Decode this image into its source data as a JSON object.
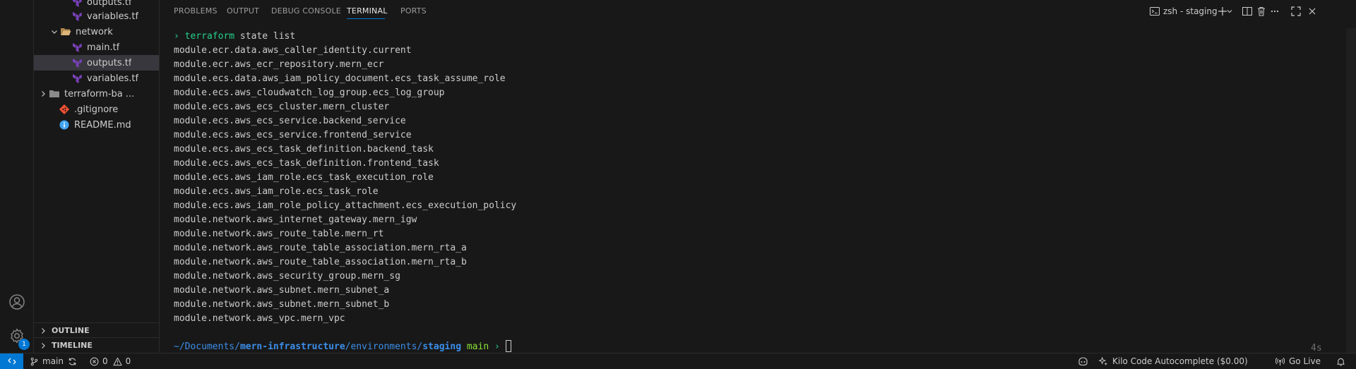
{
  "sidebar": {
    "tree": [
      {
        "label": "outputs.tf",
        "type": "terraform"
      },
      {
        "label": "variables.tf",
        "type": "terraform"
      },
      {
        "label": "network",
        "type": "folder-open"
      },
      {
        "label": "main.tf",
        "type": "terraform"
      },
      {
        "label": "outputs.tf",
        "type": "terraform",
        "selected": true
      },
      {
        "label": "variables.tf",
        "type": "terraform"
      },
      {
        "label": "terraform-ba ...",
        "type": "folder"
      },
      {
        "label": ".gitignore",
        "type": "git"
      },
      {
        "label": "README.md",
        "type": "info"
      }
    ],
    "outline_label": "OUTLINE",
    "timeline_label": "TIMELINE"
  },
  "activity": {
    "accounts_icon": "account-icon",
    "manage_icon": "gear-icon",
    "manage_badge": "1"
  },
  "panel": {
    "tabs": [
      {
        "label": "PROBLEMS"
      },
      {
        "label": "OUTPUT"
      },
      {
        "label": "DEBUG CONSOLE"
      },
      {
        "label": "TERMINAL",
        "active": true
      },
      {
        "label": "PORTS"
      }
    ],
    "terminal_title": "zsh - staging"
  },
  "terminal": {
    "prompt_symbol": "›",
    "command_name": "terraform",
    "command_args": " state list",
    "output": [
      "module.ecr.data.aws_caller_identity.current",
      "module.ecr.aws_ecr_repository.mern_ecr",
      "module.ecs.data.aws_iam_policy_document.ecs_task_assume_role",
      "module.ecs.aws_cloudwatch_log_group.ecs_log_group",
      "module.ecs.aws_ecs_cluster.mern_cluster",
      "module.ecs.aws_ecs_service.backend_service",
      "module.ecs.aws_ecs_service.frontend_service",
      "module.ecs.aws_ecs_task_definition.backend_task",
      "module.ecs.aws_ecs_task_definition.frontend_task",
      "module.ecs.aws_iam_role.ecs_task_execution_role",
      "module.ecs.aws_iam_role.ecs_task_role",
      "module.ecs.aws_iam_role_policy_attachment.ecs_execution_policy",
      "module.network.aws_internet_gateway.mern_igw",
      "module.network.aws_route_table.mern_rt",
      "module.network.aws_route_table_association.mern_rta_a",
      "module.network.aws_route_table_association.mern_rta_b",
      "module.network.aws_security_group.mern_sg",
      "module.network.aws_subnet.mern_subnet_a",
      "module.network.aws_subnet.mern_subnet_b",
      "module.network.aws_vpc.mern_vpc"
    ],
    "cwd": {
      "home": "~/",
      "seg1": "Documents",
      "sep1": "/",
      "seg2": "mern-infrastructure",
      "sep2": "/",
      "seg3": "environments",
      "sep3": "/",
      "seg4": "staging"
    },
    "branch": "main",
    "elapsed": "4s"
  },
  "status_bar": {
    "branch": "main",
    "errors": "0",
    "warnings": "0",
    "kilo_label": "Kilo Code Autocomplete ($0.00)",
    "golive_label": "Go Live"
  },
  "colors": {
    "accent": "#0078d4",
    "prompt_green": "#23d18b",
    "path_blue": "#3b8eea",
    "branch_green": "#8ae234",
    "terraform_purple": "#7b42bc"
  }
}
